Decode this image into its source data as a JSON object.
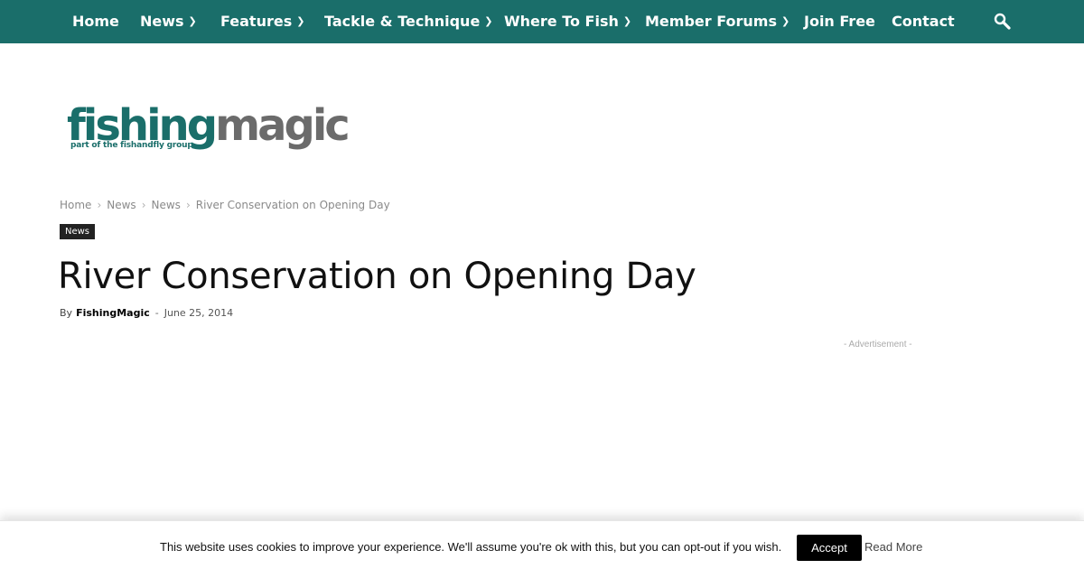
{
  "nav": {
    "items": [
      {
        "label": "Home",
        "dropdown": false
      },
      {
        "label": "News",
        "dropdown": true
      },
      {
        "label": "Features",
        "dropdown": true
      },
      {
        "label": "Tackle & Technique",
        "dropdown": true
      },
      {
        "label": "Where To Fish",
        "dropdown": true
      },
      {
        "label": "Member Forums",
        "dropdown": true
      },
      {
        "label": "Join Free",
        "dropdown": false
      },
      {
        "label": "Contact",
        "dropdown": false
      }
    ],
    "search_icon": "search-icon",
    "chevron_icon": "chevron-down-icon"
  },
  "logo": {
    "word_a": "fishing",
    "word_b": "magic",
    "tagline": "part of the fishandfly group"
  },
  "breadcrumb": {
    "items": [
      "Home",
      "News",
      "News"
    ],
    "current": "River Conservation on Opening Day"
  },
  "article": {
    "category": "News",
    "title": "River Conservation on Opening Day",
    "by_label": "By",
    "author": "FishingMagic",
    "separator": "-",
    "date": "June 25, 2014"
  },
  "ad": {
    "label": "- Advertisement -"
  },
  "cookie": {
    "text": "This website uses cookies to improve your experience. We'll assume you're ok with this, but you can opt-out if you wish.",
    "accept_label": "Accept",
    "read_more_label": "Read More"
  },
  "colors": {
    "brand_teal": "#1a6e6a",
    "logo_grey": "#6b6b6b",
    "tag_bg": "#222222"
  }
}
